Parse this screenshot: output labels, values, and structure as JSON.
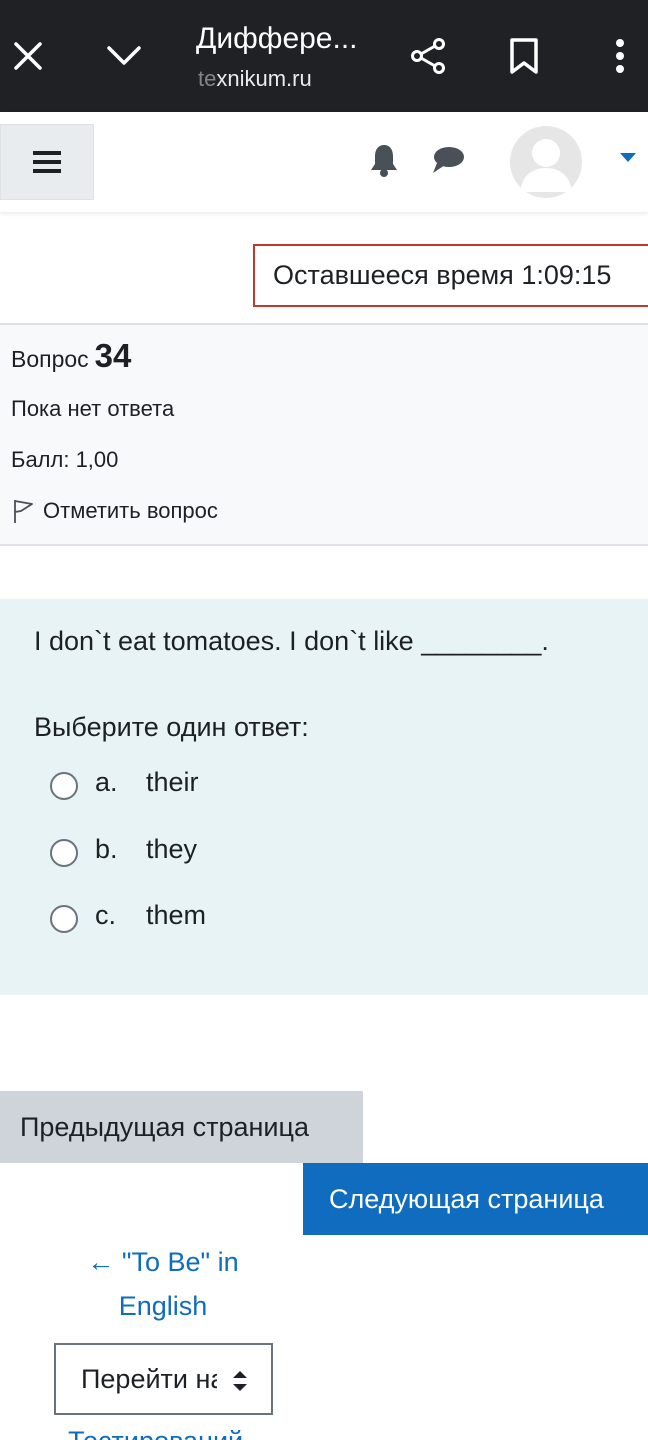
{
  "browser": {
    "tab_title": "Диффере...",
    "url_dim": "te",
    "url_main": "xnikum.ru"
  },
  "quiz": {
    "timer_label": "Оставшееся время",
    "timer_value": "1:09:15"
  },
  "question": {
    "number_label": "Вопрос",
    "number": "34",
    "state": "Пока нет ответа",
    "grade": "Балл: 1,00",
    "flag_label": "Отметить вопрос",
    "text": "I don`t eat tomatoes. I don`t like ________.",
    "prompt": "Выберите один ответ:",
    "options": [
      {
        "letter": "a.",
        "text": "their"
      },
      {
        "letter": "b.",
        "text": "they"
      },
      {
        "letter": "c.",
        "text": "them"
      }
    ]
  },
  "navigation": {
    "prev_label": "Предыдущая страница",
    "next_label": "Следующая страница",
    "prev_activity": "← \"To Be\" in English",
    "jump_label": "Перейти на...",
    "next_activity": "Тестирований →"
  },
  "colors": {
    "browser_bar": "#202124",
    "primary": "#0f6cbf",
    "timer_border": "#c0392b",
    "question_bg": "#e7f3f5"
  },
  "icons": [
    "close-icon",
    "chevron-down-icon",
    "share-icon",
    "bookmark-icon",
    "more-vert-icon",
    "hamburger-icon",
    "bell-icon",
    "chat-icon",
    "avatar-icon",
    "caret-down-icon",
    "flag-icon",
    "select-arrows-icon"
  ]
}
